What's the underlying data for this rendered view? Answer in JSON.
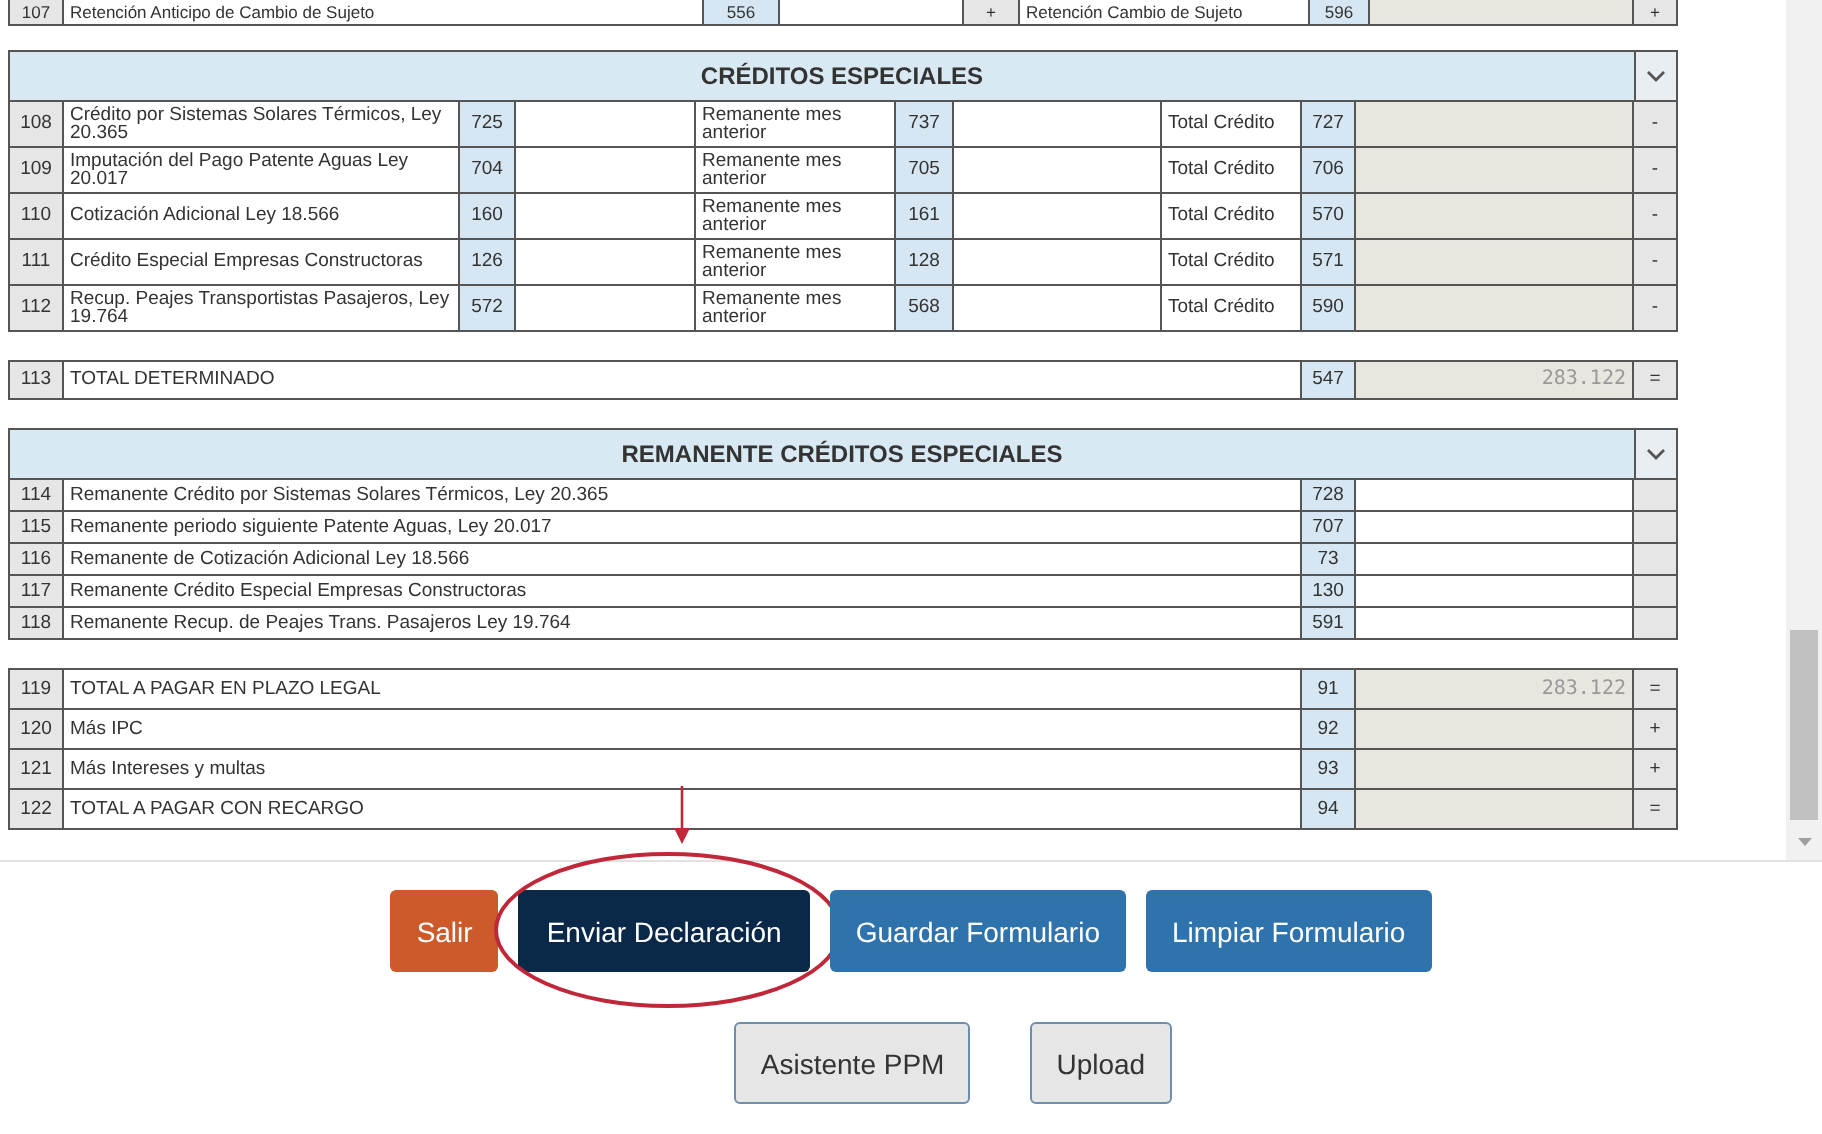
{
  "top_row": {
    "number": "107",
    "label": "Retención Anticipo de Cambio de Sujeto",
    "code": "556",
    "sign": "+",
    "label_2": "Retención Cambio de Sujeto",
    "code_2": "596",
    "sign_2": "+"
  },
  "creditos_especiales": {
    "title": "CRÉDITOS ESPECIALES",
    "rows": [
      {
        "number": "108",
        "label": "Crédito por Sistemas Solares Térmicos, Ley 20.365",
        "code": "725",
        "label_2": "Remanente mes anterior",
        "code_2": "737",
        "label_3": "Total Crédito",
        "code_3": "727",
        "sign": "-"
      },
      {
        "number": "109",
        "label": "Imputación del Pago Patente Aguas Ley 20.017",
        "code": "704",
        "label_2": "Remanente mes anterior",
        "code_2": "705",
        "label_3": "Total Crédito",
        "code_3": "706",
        "sign": "-"
      },
      {
        "number": "110",
        "label": "Cotización Adicional Ley 18.566",
        "code": "160",
        "label_2": "Remanente mes anterior",
        "code_2": "161",
        "label_3": "Total Crédito",
        "code_3": "570",
        "sign": "-"
      },
      {
        "number": "111",
        "label": "Crédito Especial Empresas Constructoras",
        "code": "126",
        "label_2": "Remanente mes anterior",
        "code_2": "128",
        "label_3": "Total Crédito",
        "code_3": "571",
        "sign": "-"
      },
      {
        "number": "112",
        "label": "Recup. Peajes Transportistas Pasajeros, Ley 19.764",
        "code": "572",
        "label_2": "Remanente mes anterior",
        "code_2": "568",
        "label_3": "Total Crédito",
        "code_3": "590",
        "sign": "-"
      }
    ]
  },
  "total_determinado": {
    "number": "113",
    "label": "TOTAL DETERMINADO",
    "code": "547",
    "value": "283.122",
    "sign": "="
  },
  "remanente_creditos_especiales": {
    "title": "REMANENTE CRÉDITOS ESPECIALES",
    "rows": [
      {
        "number": "114",
        "label": "Remanente Crédito por Sistemas Solares Térmicos, Ley 20.365",
        "code": "728"
      },
      {
        "number": "115",
        "label": "Remanente periodo siguiente Patente Aguas, Ley 20.017",
        "code": "707"
      },
      {
        "number": "116",
        "label": "Remanente de Cotización Adicional Ley 18.566",
        "code": "73"
      },
      {
        "number": "117",
        "label": "Remanente Crédito Especial Empresas Constructoras",
        "code": "130"
      },
      {
        "number": "118",
        "label": "Remanente Recup. de Peajes Trans. Pasajeros Ley 19.764",
        "code": "591"
      }
    ]
  },
  "totales": [
    {
      "number": "119",
      "label": "TOTAL A PAGAR EN PLAZO LEGAL",
      "code": "91",
      "value": "283.122",
      "sign": "="
    },
    {
      "number": "120",
      "label": "Más IPC",
      "code": "92",
      "sign": "+"
    },
    {
      "number": "121",
      "label": "Más Intereses y multas",
      "code": "93",
      "sign": "+"
    },
    {
      "number": "122",
      "label": "TOTAL A PAGAR CON RECARGO",
      "code": "94",
      "sign": "="
    }
  ],
  "buttons": [
    {
      "label": "Salir",
      "kind": "danger",
      "highlighted": false
    },
    {
      "label": "Enviar Declaración",
      "kind": "dark",
      "highlighted": true
    },
    {
      "label": "Guardar Formulario",
      "kind": "primary",
      "highlighted": false
    },
    {
      "label": "Limpiar Formulario",
      "kind": "primary",
      "highlighted": false
    }
  ],
  "secondary_buttons": [
    {
      "label": "Asistente PPM",
      "kind": "default"
    },
    {
      "label": "Upload",
      "kind": "default"
    }
  ]
}
